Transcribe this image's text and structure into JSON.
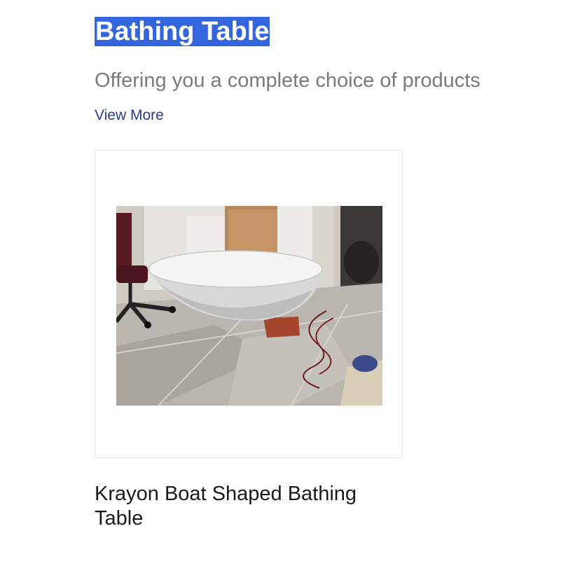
{
  "section": {
    "title": "Bathing Table",
    "subtitle": "Offering you a complete choice of products",
    "view_more": "View More"
  },
  "product": {
    "name": "Krayon Boat Shaped Bathing Table",
    "image_alt": "Boat shaped bathing table photo"
  },
  "colors": {
    "title_highlight": "#3366dd",
    "link": "#2a3a8c",
    "subtitle": "#7a7a7a"
  }
}
